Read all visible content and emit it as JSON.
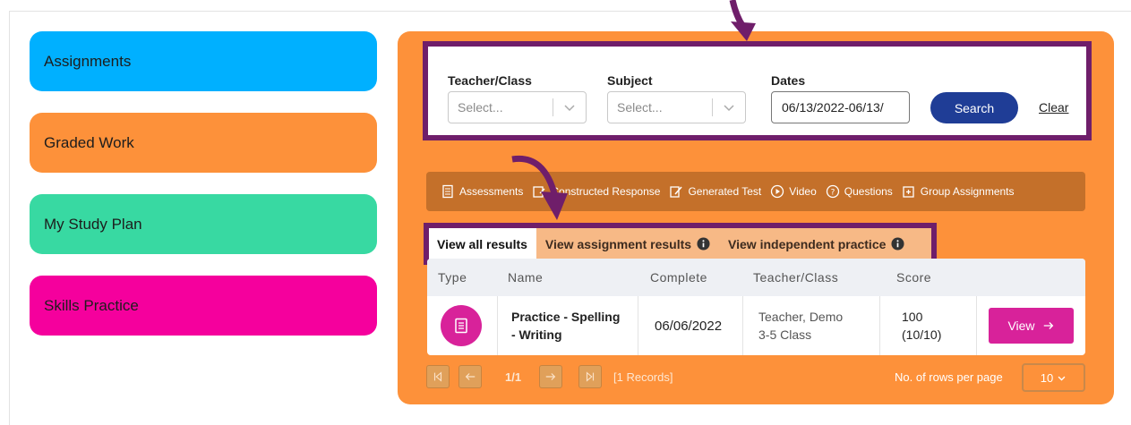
{
  "nav": {
    "items": [
      {
        "label": "Assignments",
        "color": "#00b0ff"
      },
      {
        "label": "Graded Work",
        "color": "#fd913a"
      },
      {
        "label": "My Study Plan",
        "color": "#38d9a2"
      },
      {
        "label": "Skills Practice",
        "color": "#f5009d"
      }
    ]
  },
  "filters": {
    "teacher_label": "Teacher/Class",
    "teacher_placeholder": "Select...",
    "subject_label": "Subject",
    "subject_placeholder": "Select...",
    "dates_label": "Dates",
    "dates_value": "06/13/2022-06/13/",
    "search_label": "Search",
    "clear_label": "Clear"
  },
  "toolbar": {
    "items": [
      {
        "label": "Assessments",
        "icon": "document-icon"
      },
      {
        "label": "Constructed Response",
        "icon": "note-icon"
      },
      {
        "label": "Generated Test",
        "icon": "edit-icon"
      },
      {
        "label": "Video",
        "icon": "play-icon"
      },
      {
        "label": "Questions",
        "icon": "question-icon"
      },
      {
        "label": "Group Assignments",
        "icon": "group-icon"
      }
    ]
  },
  "tabs": [
    {
      "label": "View all results",
      "active": true
    },
    {
      "label": "View assignment results",
      "info": true
    },
    {
      "label": "View independent practice",
      "info": true
    }
  ],
  "table": {
    "headers": [
      "Type",
      "Name",
      "Complete",
      "Teacher/Class",
      "Score"
    ],
    "rows": [
      {
        "name_line1": "Practice - Spelling",
        "name_line2": "- Writing",
        "complete": "06/06/2022",
        "teacher": "Teacher, Demo",
        "class": "3-5 Class",
        "score_line1": "100",
        "score_line2": "(10/10)",
        "action": "View"
      }
    ]
  },
  "pager": {
    "page": "1/1",
    "records": "[1 Records]",
    "rows_label": "No. of rows per page",
    "rows_value": "10"
  },
  "colors": {
    "panel": "#fd913a",
    "highlight": "#6f1e6a",
    "search": "#1f3d96",
    "view": "#d8229a"
  }
}
